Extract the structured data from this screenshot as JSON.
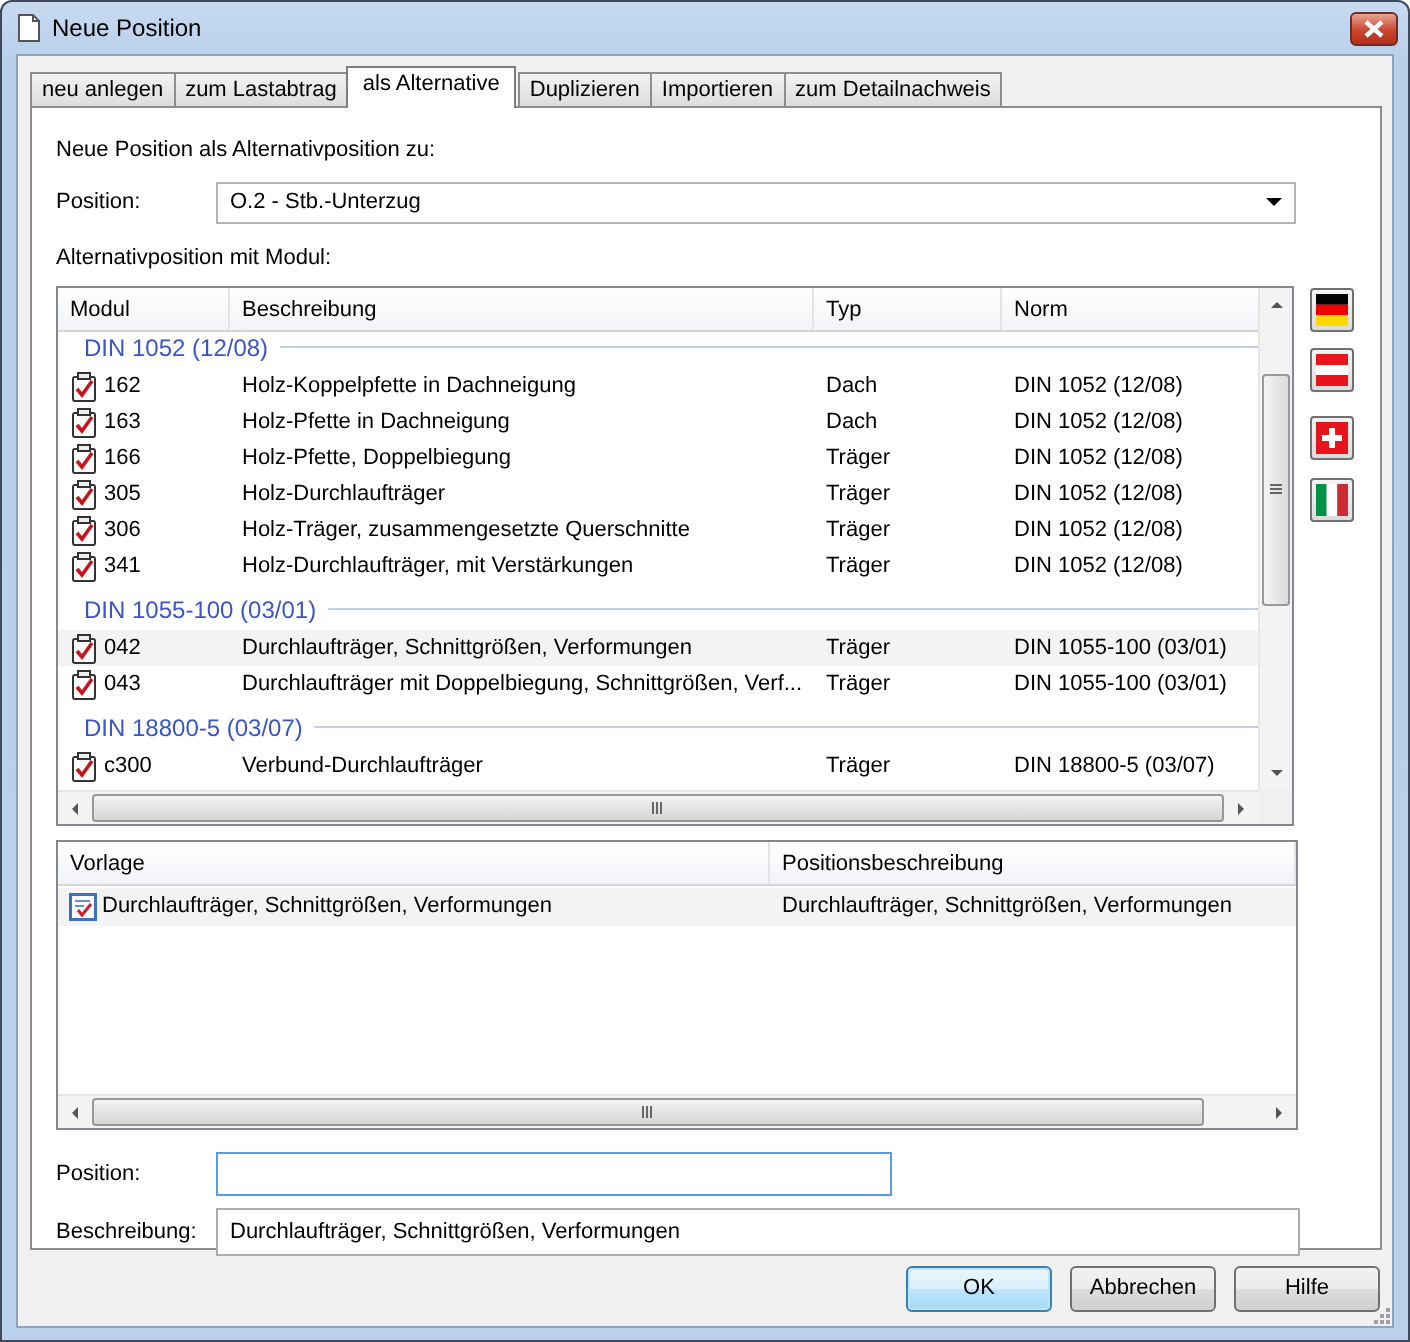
{
  "window": {
    "title": "Neue Position"
  },
  "tabs": [
    {
      "label": "neu anlegen",
      "selected": false
    },
    {
      "label": "zum Lastabtrag",
      "selected": false
    },
    {
      "label": "als Alternative",
      "selected": true
    },
    {
      "label": "Duplizieren",
      "selected": false
    },
    {
      "label": "Importieren",
      "selected": false
    },
    {
      "label": "zum Detailnachweis",
      "selected": false
    }
  ],
  "intro": "Neue Position als Alternativposition zu:",
  "position_select": {
    "label": "Position:",
    "value": "O.2 - Stb.-Unterzug"
  },
  "module_list": {
    "label": "Alternativposition mit Modul:",
    "columns": [
      "Modul",
      "Beschreibung",
      "Typ",
      "Norm"
    ],
    "groups": [
      {
        "title": "DIN 1052 (12/08)",
        "rows": [
          {
            "modul": "162",
            "beschreibung": "Holz-Koppelpfette in Dachneigung",
            "typ": "Dach",
            "norm": "DIN 1052 (12/08)",
            "checked": true,
            "selected": false
          },
          {
            "modul": "163",
            "beschreibung": "Holz-Pfette in Dachneigung",
            "typ": "Dach",
            "norm": "DIN 1052 (12/08)",
            "checked": true,
            "selected": false
          },
          {
            "modul": "166",
            "beschreibung": "Holz-Pfette, Doppelbiegung",
            "typ": "Träger",
            "norm": "DIN 1052 (12/08)",
            "checked": true,
            "selected": false
          },
          {
            "modul": "305",
            "beschreibung": "Holz-Durchlaufträger",
            "typ": "Träger",
            "norm": "DIN 1052 (12/08)",
            "checked": true,
            "selected": false
          },
          {
            "modul": "306",
            "beschreibung": "Holz-Träger, zusammengesetzte Querschnitte",
            "typ": "Träger",
            "norm": "DIN 1052 (12/08)",
            "checked": true,
            "selected": false
          },
          {
            "modul": "341",
            "beschreibung": "Holz-Durchlaufträger, mit Verstärkungen",
            "typ": "Träger",
            "norm": "DIN 1052 (12/08)",
            "checked": true,
            "selected": false
          }
        ]
      },
      {
        "title": "DIN 1055-100 (03/01)",
        "rows": [
          {
            "modul": "042",
            "beschreibung": "Durchlaufträger, Schnittgrößen, Verformungen",
            "typ": "Träger",
            "norm": "DIN 1055-100 (03/01)",
            "checked": true,
            "selected": true
          },
          {
            "modul": "043",
            "beschreibung": "Durchlaufträger mit Doppelbiegung, Schnittgrößen, Verf...",
            "typ": "Träger",
            "norm": "DIN 1055-100 (03/01)",
            "checked": true,
            "selected": false
          }
        ]
      },
      {
        "title": "DIN 18800-5 (03/07)",
        "rows": [
          {
            "modul": "c300",
            "beschreibung": "Verbund-Durchlaufträger",
            "typ": "Träger",
            "norm": "DIN 18800-5 (03/07)",
            "checked": true,
            "selected": false
          }
        ]
      }
    ]
  },
  "template_list": {
    "columns": [
      "Vorlage",
      "Positionsbeschreibung"
    ],
    "rows": [
      {
        "vorlage": "Durchlaufträger, Schnittgrößen, Verformungen",
        "positionsbeschreibung": "Durchlaufträger, Schnittgrößen, Verformungen",
        "selected": true
      }
    ]
  },
  "fields": [
    {
      "label": "Position:",
      "focused": true
    },
    {
      "label": "Beschreibung:",
      "value": "Durchlaufträger, Schnittgrößen, Verformungen",
      "focused": false
    }
  ],
  "buttons": [
    {
      "label": "OK",
      "default": true
    },
    {
      "label": "Abbrechen",
      "default": false
    },
    {
      "label": "Hilfe",
      "default": false
    }
  ]
}
